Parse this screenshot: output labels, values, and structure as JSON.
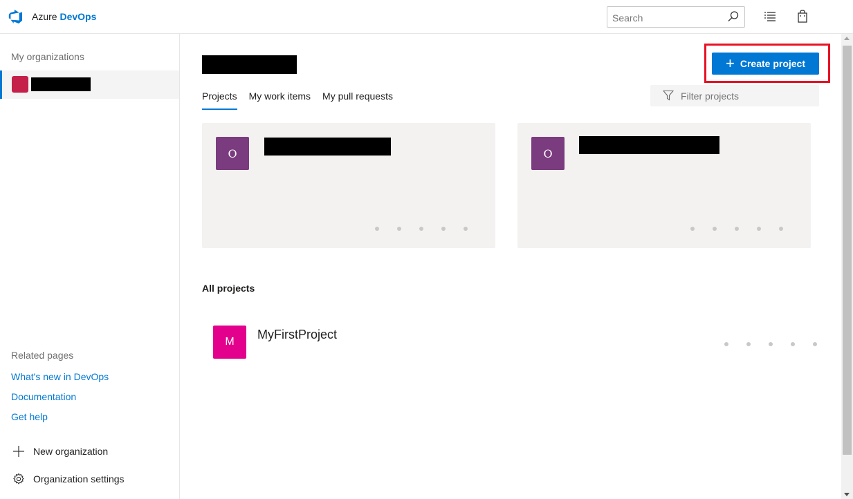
{
  "header": {
    "brand_light": "Azure",
    "brand_strong": "DevOps",
    "logo_icon": "azure-devops-logo-icon",
    "search_placeholder": "Search",
    "icons": [
      "search-icon",
      "task-list-icon",
      "shopping-bag-icon"
    ]
  },
  "sidebar": {
    "org_heading": "My organizations",
    "org_name": "",
    "related_heading": "Related pages",
    "links": [
      "What's new in DevOps",
      "Documentation",
      "Get help"
    ],
    "new_org": "New organization",
    "org_settings": "Organization settings"
  },
  "main": {
    "create_button": "Create project",
    "tabs": [
      "Projects",
      "My work items",
      "My pull requests"
    ],
    "filter_placeholder": "Filter projects",
    "cards": [
      {
        "initial": "O",
        "name": ""
      },
      {
        "initial": "O",
        "name": ""
      }
    ],
    "all_heading": "All projects",
    "projects": [
      {
        "initial": "M",
        "name": "MyFirstProject"
      }
    ]
  },
  "colors": {
    "accent": "#0078d4",
    "highlight": "#e81123",
    "card_avatar": "#7b3b7f",
    "project_avatar": "#e3008c",
    "org_avatar": "#c4204a"
  }
}
